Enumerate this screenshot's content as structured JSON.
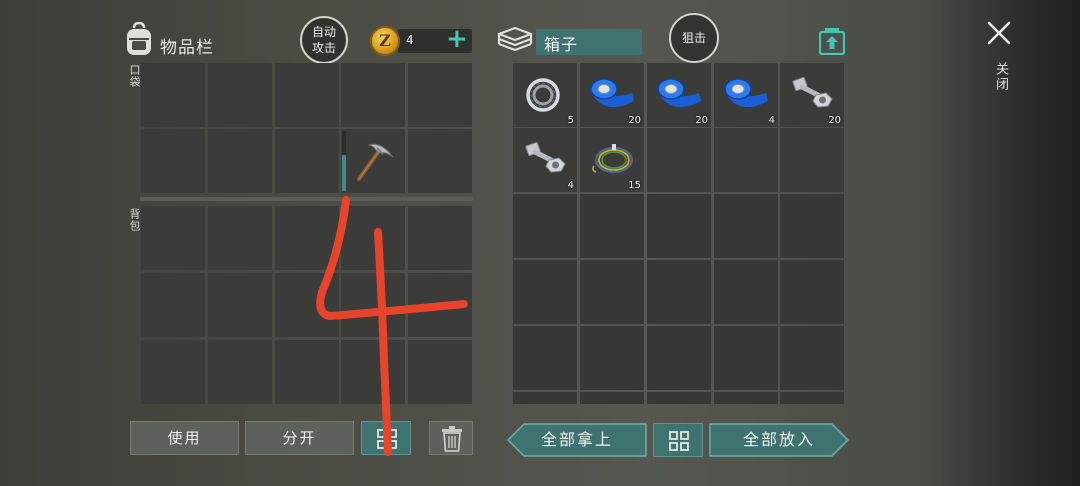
{
  "inventory": {
    "title": "物品栏",
    "auto_attack_line1": "自动",
    "auto_attack_line2": "攻击",
    "pocket_label": "口袋",
    "backpack_label": "背包"
  },
  "currency": {
    "count": "4",
    "coin_symbol": "Z",
    "plus": "+"
  },
  "container": {
    "name": "箱子",
    "snipe_label": "狙击"
  },
  "close_label": "关闭",
  "container_items": [
    {
      "name": "bearing-item",
      "qty": "5"
    },
    {
      "name": "blue-tape-item",
      "qty": "20"
    },
    {
      "name": "blue-tape-item",
      "qty": "20"
    },
    {
      "name": "blue-tape-item",
      "qty": "4"
    },
    {
      "name": "bolt-nut-item",
      "qty": "20"
    },
    {
      "name": "bolt-nut-item",
      "qty": "4"
    },
    {
      "name": "wires-item",
      "qty": "15"
    }
  ],
  "pocket_items": [
    {
      "name": "pickaxe-item",
      "durability": 0.6
    }
  ],
  "buttons": {
    "use": "使用",
    "split": "分开",
    "take_all": "全部拿上",
    "put_all": "全部放入"
  },
  "colors": {
    "teal": "#3f7370",
    "accent": "#43c7b2",
    "annotation": "#e8432b"
  },
  "annotation_text": "4"
}
